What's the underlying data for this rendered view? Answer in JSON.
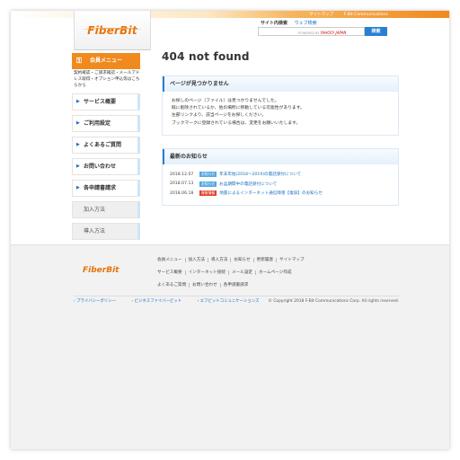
{
  "header": {
    "top_links": [
      "サイトマップ",
      "F-Bit Communications"
    ],
    "logo": "FiberBit",
    "search_tabs": {
      "active": "サイト内検索",
      "other": "ウェブ検索"
    },
    "search_powered": "POWERED BY",
    "search_brand": "YAHOO! JAPAN",
    "search_button": "検索"
  },
  "sidebar": {
    "member_menu": "会員メニュー",
    "member_desc": "契約確認・ご請求確認・メールアドレス取得・オプション申込等はこちらから",
    "items": [
      {
        "label": "サービス概要",
        "arrow": true
      },
      {
        "label": "ご利用設定",
        "arrow": true
      },
      {
        "label": "よくあるご質問",
        "arrow": true
      },
      {
        "label": "お問い合わせ",
        "arrow": true
      },
      {
        "label": "各申請書請求",
        "arrow": true
      },
      {
        "label": "加入方法",
        "arrow": false
      },
      {
        "label": "導入方法",
        "arrow": false
      }
    ]
  },
  "main": {
    "title": "404 not found",
    "notfound_heading": "ページが見つかりません",
    "notfound_lines": [
      "お探しのページ（ファイル）は見つかりませんでした。",
      "既に削除されているか、他の場所に移動している可能性があります。",
      "左部リンクより、該当ページをお探しください。",
      "ブックマークに登録されている場合は、変更をお願いいたします。"
    ],
    "news_heading": "最新のお知らせ",
    "news": [
      {
        "date": "2018.12.07",
        "badge": "お知らせ",
        "badge_color": "#58a8e2",
        "text": "年末年始(2018〜2019)の電話受付について"
      },
      {
        "date": "2018.07.13",
        "badge": "お知らせ",
        "badge_color": "#58a8e2",
        "text": "お盆期間中の電話受付について"
      },
      {
        "date": "2018.06.18",
        "badge": "障害情報",
        "badge_color": "#e2422d",
        "text": "地震によるインターネット通信障害【復旧】のお知らせ"
      }
    ]
  },
  "footer": {
    "logo": "FiberBit",
    "rows": [
      [
        "会員メニュー",
        "加入方法",
        "導入方法",
        "お知らせ",
        "更新履歴",
        "サイトマップ"
      ],
      [
        "サービス概要",
        "インターネット接続",
        "メール設定",
        "ホームページ作成"
      ],
      [
        "よくあるご質問",
        "お問い合わせ",
        "各申請書請求"
      ]
    ],
    "bottom_links": [
      "プライバシーポリシー",
      "ビジネスファイバービット",
      "エフビットコミュニケーションズ"
    ],
    "copyright": "Copyright 2018 F-Bit Communications Corp. All rights reserved."
  },
  "colors": {
    "accent": "#f08a1e",
    "link": "#1a6fc0",
    "alert": "#e2422d"
  }
}
